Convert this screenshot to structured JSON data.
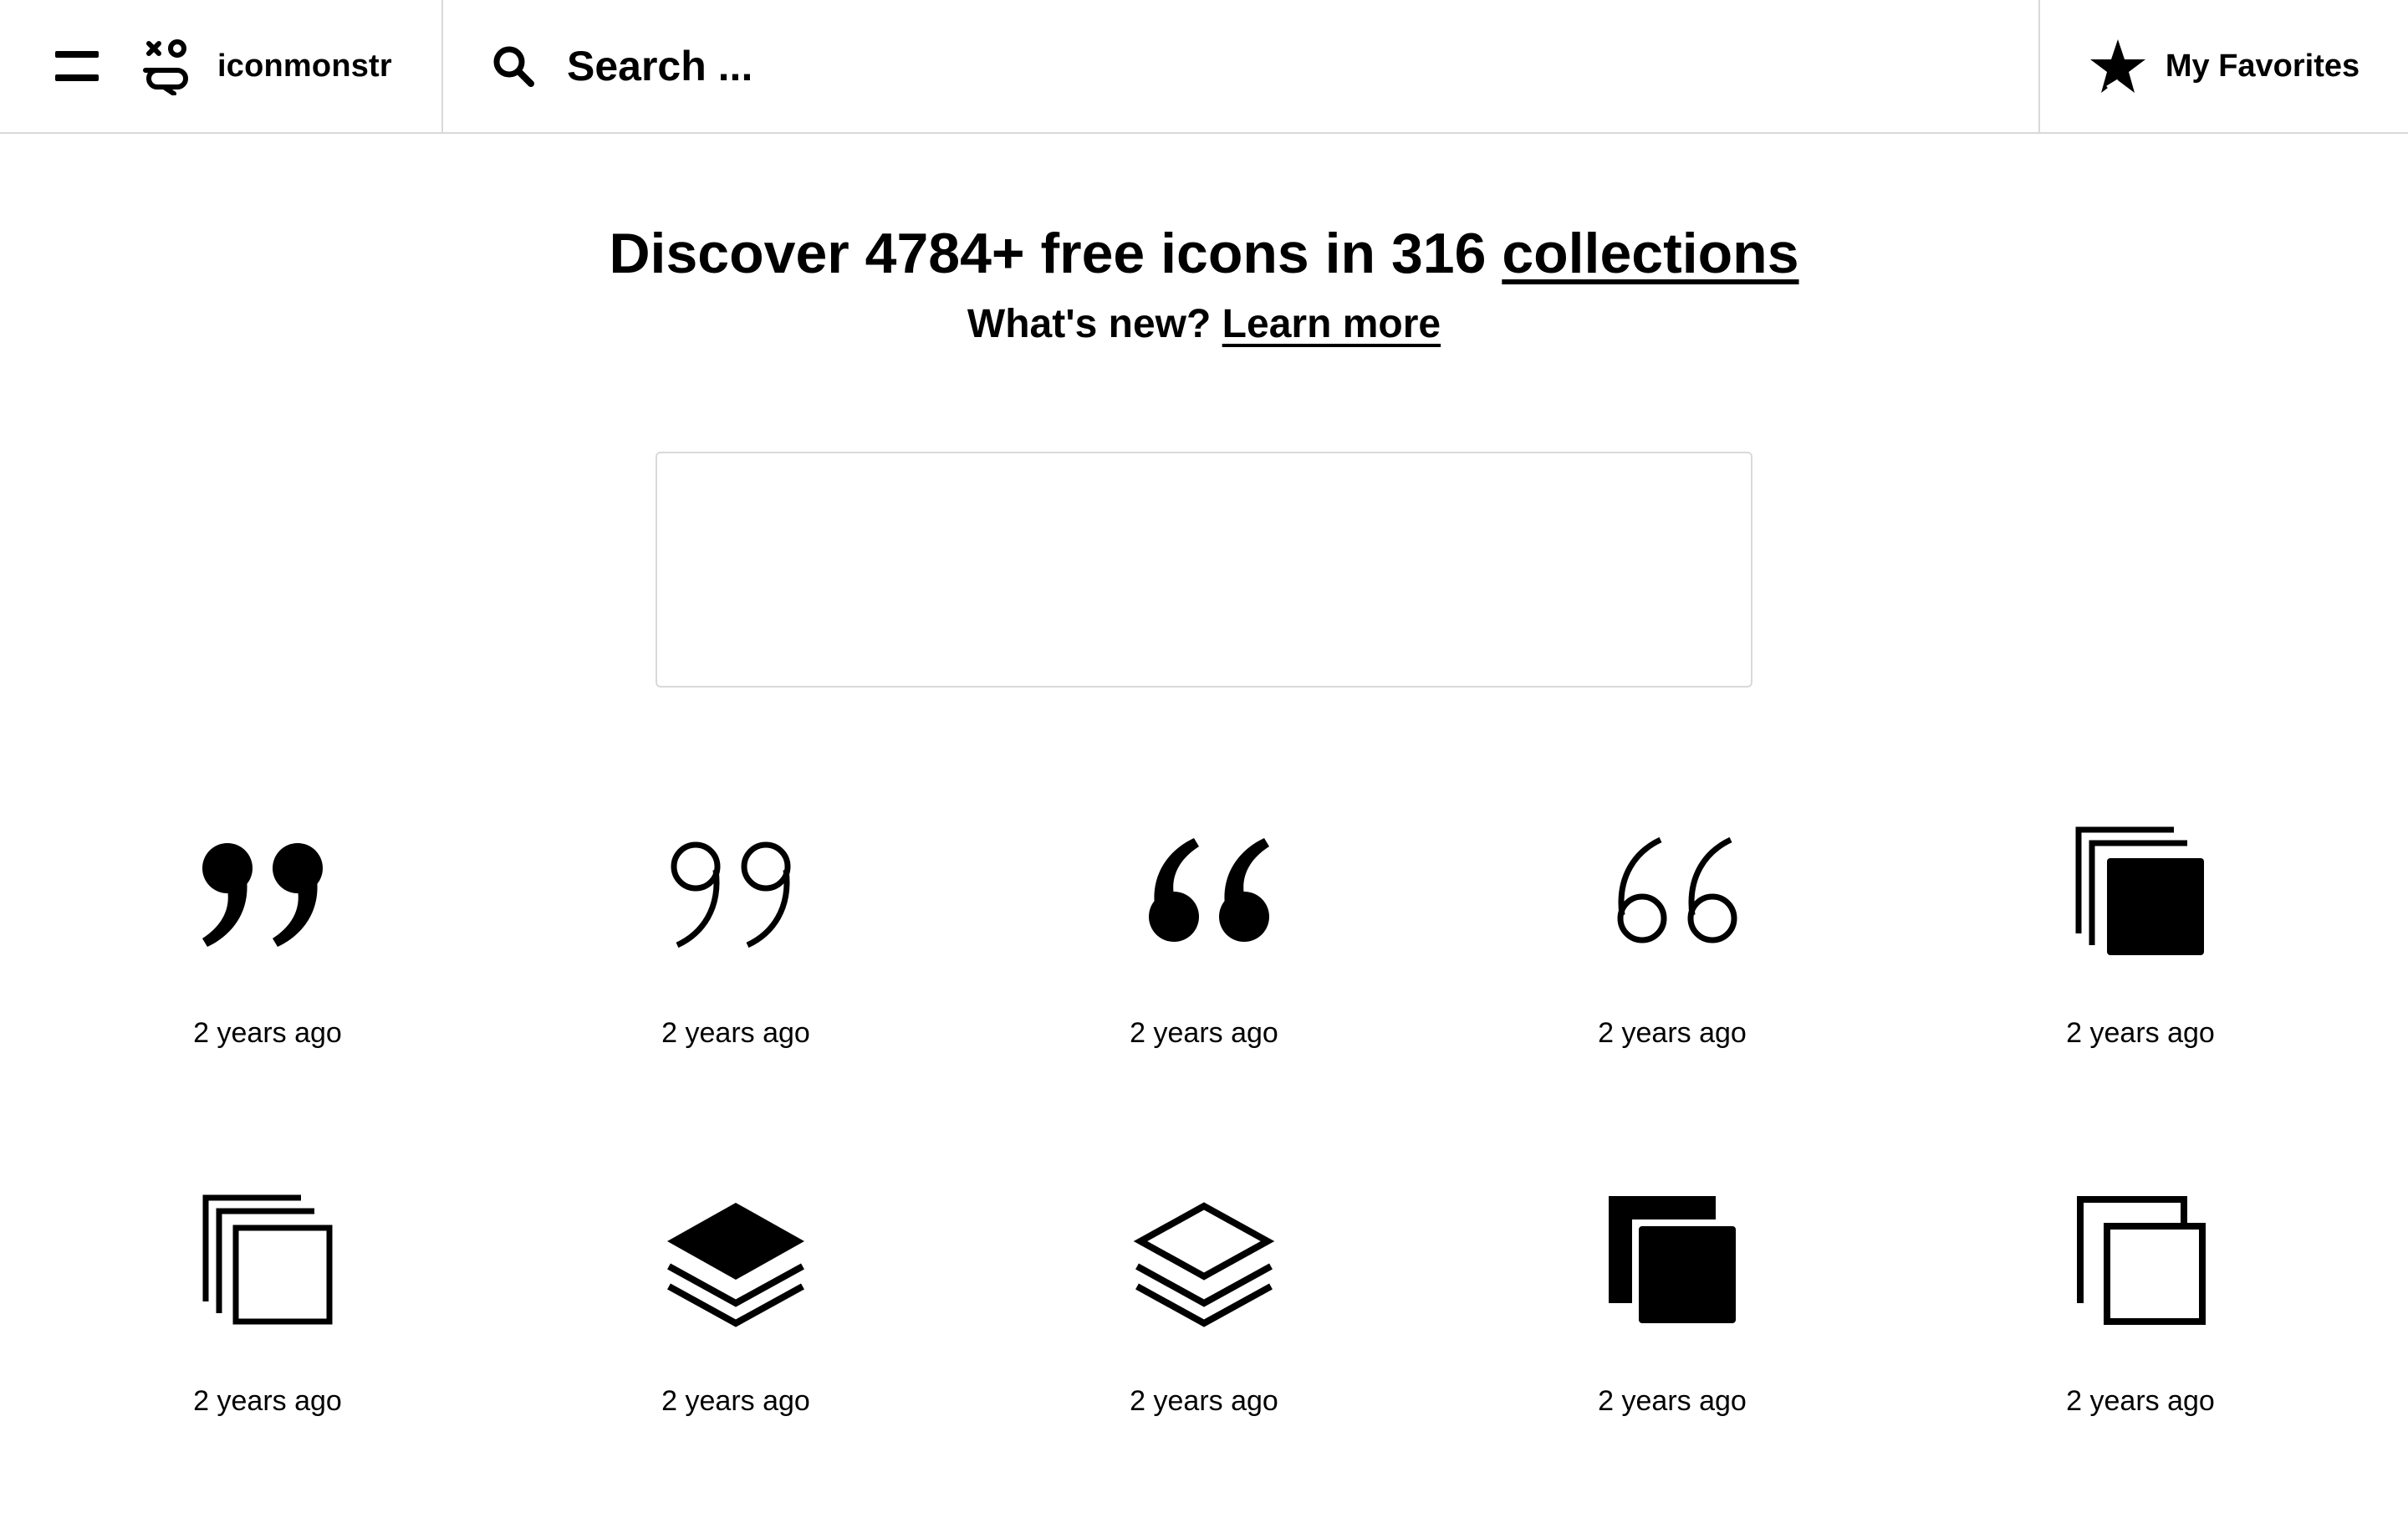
{
  "header": {
    "brand": "iconmonstr",
    "search_placeholder": "Search ...",
    "favorites_label": "My Favorites"
  },
  "hero": {
    "title_prefix": "Discover 4784+ free icons in 316 ",
    "title_link": "collections",
    "sub_prefix": "What's new? ",
    "sub_link": "Learn more"
  },
  "icons": [
    {
      "icon": "quote-close-filled-icon",
      "time": "2 years ago"
    },
    {
      "icon": "quote-close-outline-icon",
      "time": "2 years ago"
    },
    {
      "icon": "quote-open-filled-icon",
      "time": "2 years ago"
    },
    {
      "icon": "quote-open-outline-icon",
      "time": "2 years ago"
    },
    {
      "icon": "stacked-squares-filled-icon",
      "time": "2 years ago"
    },
    {
      "icon": "stacked-squares-outline-icon",
      "time": "2 years ago"
    },
    {
      "icon": "layers-filled-icon",
      "time": "2 years ago"
    },
    {
      "icon": "layers-outline-icon",
      "time": "2 years ago"
    },
    {
      "icon": "copy-filled-icon",
      "time": "2 years ago"
    },
    {
      "icon": "copy-outline-icon",
      "time": "2 years ago"
    }
  ]
}
